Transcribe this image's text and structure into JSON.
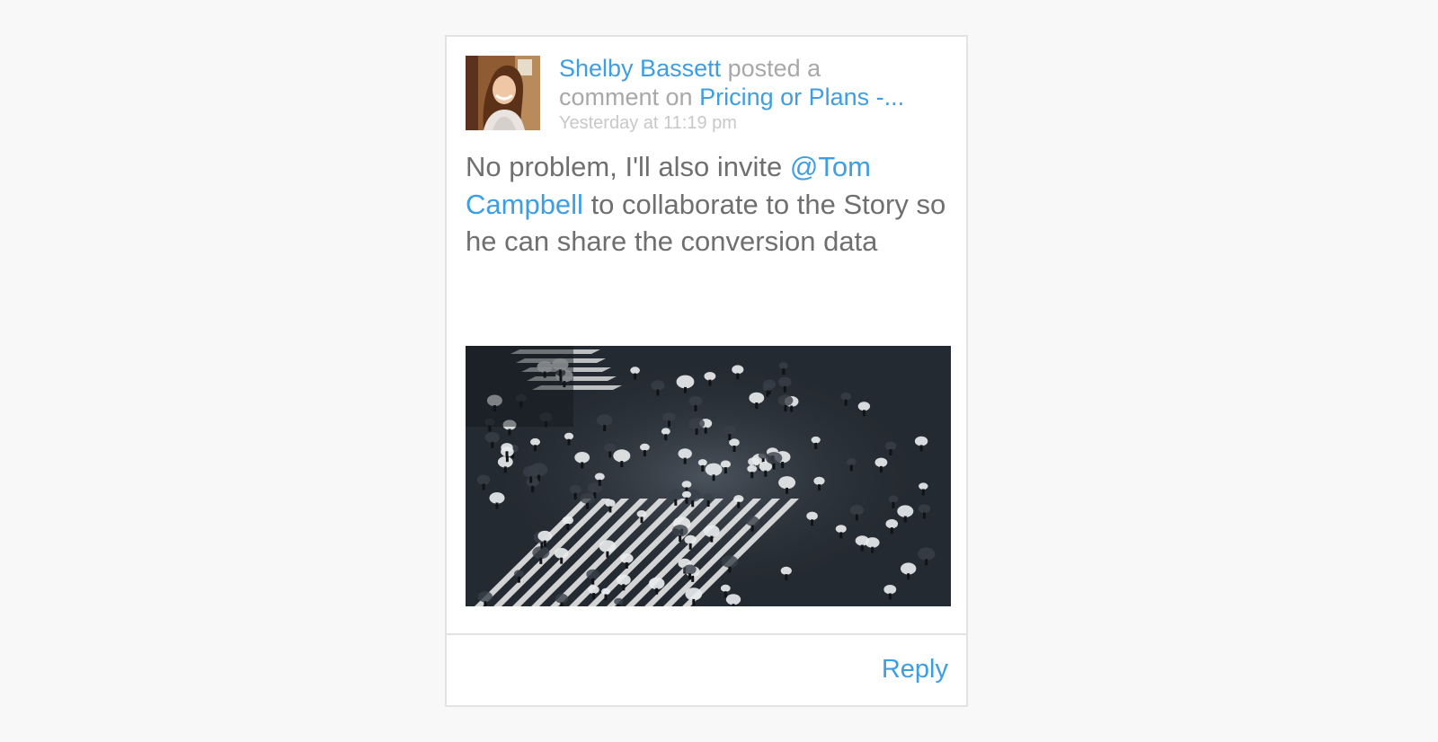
{
  "post": {
    "author": "Shelby Bassett",
    "action_part1": " posted a",
    "action_part2": "comment on ",
    "target": "Pricing or Plans -...",
    "timestamp": "Yesterday at 11:19 pm",
    "body_before": "No problem, I'll also invite ",
    "mention": "@Tom Campbell",
    "body_after": " to collaborate to the Story so he can share the conversion data"
  },
  "footer": {
    "reply_label": "Reply"
  },
  "colors": {
    "link": "#3d9ee3",
    "body_text": "#6f6f6f",
    "muted_text": "#a8a8a8",
    "timestamp": "#c8c8c8",
    "border": "#e3e3e3",
    "background": "#f8f8f8"
  },
  "images": {
    "avatar": "avatar-photo",
    "attachment": "photo-umbrellas-crosswalk"
  }
}
